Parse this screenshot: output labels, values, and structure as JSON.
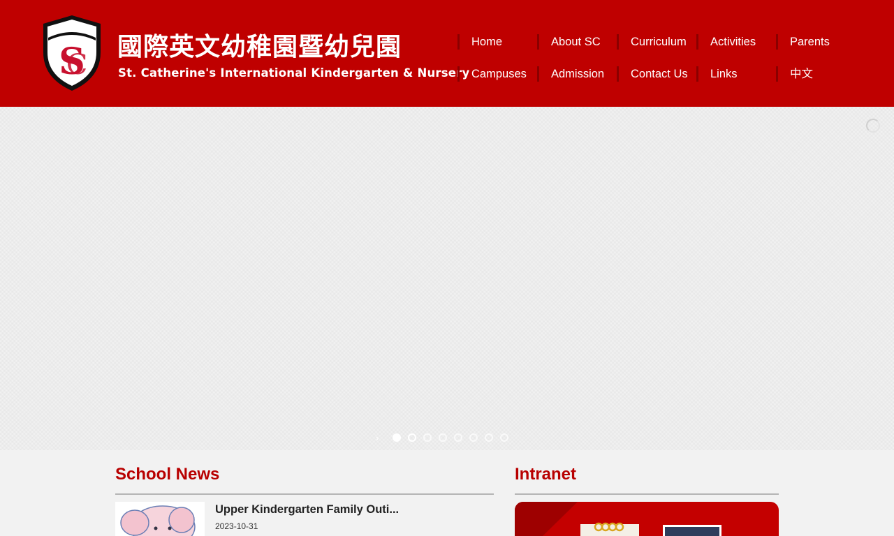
{
  "header": {
    "brand_zh": "國際英文幼稚園暨幼兒園",
    "brand_en": "St. Catherine's International Kindergarten & Nursery",
    "logo_letters": "SC"
  },
  "nav": {
    "row1": [
      "Home",
      "About SC",
      "Curriculum",
      "Activities",
      "Parents"
    ],
    "row2": [
      "Campuses",
      "Admission",
      "Contact Us",
      "Links",
      "中文"
    ]
  },
  "slider": {
    "slide_count": 8,
    "active_index": 0
  },
  "news": {
    "heading": "School News",
    "items": [
      {
        "title": "Upper Kindergarten Family Outi...",
        "date": "2023-10-31"
      }
    ]
  },
  "intranet": {
    "heading": "Intranet"
  },
  "colors": {
    "brand_red": "#bf0000",
    "title_red": "#b80000",
    "page_bg": "#f2f2f2"
  }
}
